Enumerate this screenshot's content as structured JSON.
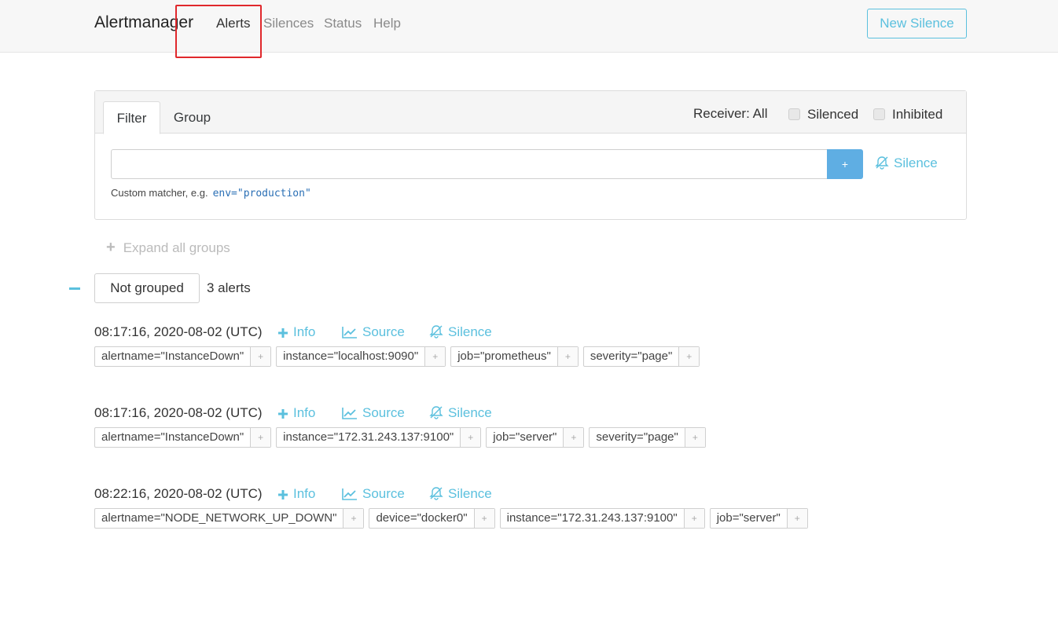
{
  "navbar": {
    "brand": "Alertmanager",
    "links": [
      {
        "label": "Alerts",
        "active": true
      },
      {
        "label": "Silences",
        "active": false
      },
      {
        "label": "Status",
        "active": false
      },
      {
        "label": "Help",
        "active": false
      }
    ],
    "new_silence_label": "New Silence"
  },
  "filter": {
    "tabs": [
      "Filter",
      "Group"
    ],
    "receiver_label": "Receiver: All",
    "silenced_label": "Silenced",
    "inhibited_label": "Inhibited",
    "input_value": "",
    "input_placeholder": "",
    "plus_label": "+",
    "silence_label": "Silence",
    "hint_text": "Custom matcher, e.g.",
    "hint_example": "env=\"production\""
  },
  "expand_all_label": "Expand all groups",
  "group": {
    "name": "Not grouped",
    "count_text": "3 alerts"
  },
  "actions": {
    "info_label": "Info",
    "source_label": "Source",
    "silence_label": "Silence"
  },
  "alerts": [
    {
      "timestamp": "08:17:16, 2020-08-02 (UTC)",
      "labels": [
        "alertname=\"InstanceDown\"",
        "instance=\"localhost:9090\"",
        "job=\"prometheus\"",
        "severity=\"page\""
      ]
    },
    {
      "timestamp": "08:17:16, 2020-08-02 (UTC)",
      "labels": [
        "alertname=\"InstanceDown\"",
        "instance=\"172.31.243.137:9100\"",
        "job=\"server\"",
        "severity=\"page\""
      ]
    },
    {
      "timestamp": "08:22:16, 2020-08-02 (UTC)",
      "labels": [
        "alertname=\"NODE_NETWORK_UP_DOWN\"",
        "device=\"docker0\"",
        "instance=\"172.31.243.137:9100\"",
        "job=\"server\""
      ]
    }
  ],
  "label_add_glyph": "+",
  "colors": {
    "accent": "#5bc0de",
    "plus_button": "#5faee3",
    "highlight": "#e0282c"
  }
}
